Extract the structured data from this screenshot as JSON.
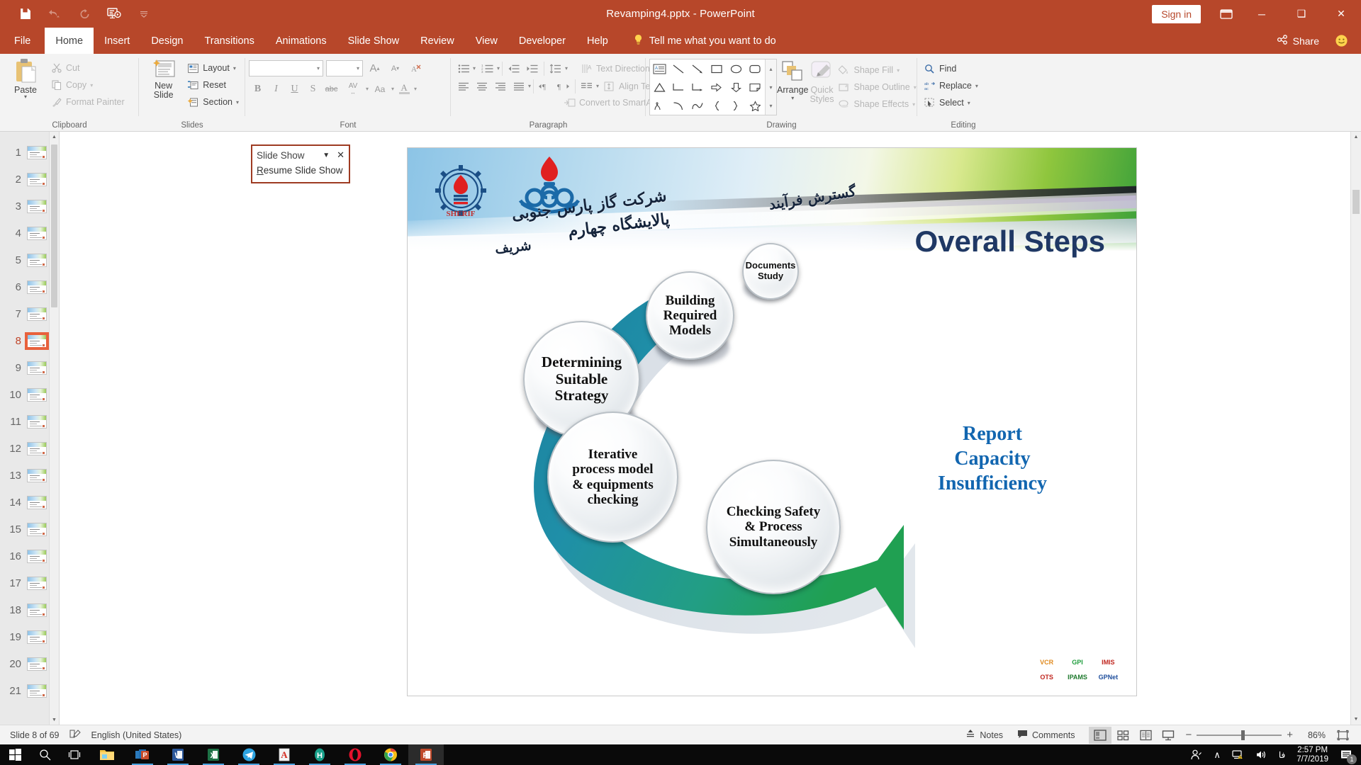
{
  "titlebar": {
    "document_title": "Revamping4.pptx  -  PowerPoint",
    "sign_in": "Sign in",
    "qat": [
      {
        "name": "save-icon",
        "glyph": "💾"
      },
      {
        "name": "undo-icon",
        "glyph": "↶"
      },
      {
        "name": "redo-icon",
        "glyph": "↻"
      },
      {
        "name": "start-slideshow-icon",
        "glyph": "⌨"
      },
      {
        "name": "customize-qat-icon",
        "glyph": "≡"
      }
    ],
    "window_buttons": {
      "minimize": "─",
      "restore": "❑",
      "close": "✕"
    },
    "ribbon_display_options": "❐"
  },
  "tabs": {
    "items": [
      "File",
      "Home",
      "Insert",
      "Design",
      "Transitions",
      "Animations",
      "Slide Show",
      "Review",
      "View",
      "Developer",
      "Help"
    ],
    "active": "Home",
    "tell_me": "Tell me what you want to do",
    "share": "Share"
  },
  "ribbon": {
    "clipboard": {
      "label": "Clipboard",
      "paste": "Paste",
      "cut": "Cut",
      "copy": "Copy",
      "format_painter": "Format Painter"
    },
    "slides": {
      "label": "Slides",
      "new_slide": "New\nSlide",
      "new_slide_line1": "New",
      "new_slide_line2": "Slide",
      "layout": "Layout",
      "reset": "Reset",
      "section": "Section"
    },
    "font": {
      "label": "Font",
      "font_name_value": "",
      "font_size_value": "",
      "grow": "A",
      "shrink": "A",
      "clear_formatting": "A",
      "bold": "B",
      "italic": "I",
      "underline": "U",
      "shadow": "S",
      "strikethrough": "abc",
      "character_spacing": "AV",
      "change_case": "Aa",
      "font_color": "A"
    },
    "paragraph": {
      "label": "Paragraph",
      "text_direction": "Text Direction",
      "align_text": "Align Text",
      "convert_smartart": "Convert to SmartArt"
    },
    "drawing": {
      "label": "Drawing",
      "arrange": "Arrange",
      "quick_styles_line1": "Quick",
      "quick_styles_line2": "Styles",
      "shape_fill": "Shape Fill",
      "shape_outline": "Shape Outline",
      "shape_effects": "Shape Effects"
    },
    "editing": {
      "label": "Editing",
      "find": "Find",
      "replace": "Replace",
      "select": "Select"
    }
  },
  "slideshow_popup": {
    "title": "Slide Show",
    "resume": "Resume Slide Show",
    "resume_accel": "R",
    "resume_rest": "esume Slide Show",
    "collapse_icon": "▼",
    "close_icon": "✕",
    "border_color": "#9e3b22"
  },
  "thumbnails": {
    "selected": 8,
    "items": [
      1,
      2,
      3,
      4,
      5,
      6,
      7,
      8,
      9,
      10,
      11,
      12,
      13,
      14,
      15,
      16,
      17,
      18,
      19,
      20,
      21
    ]
  },
  "slide": {
    "title": "Overall Steps",
    "title_color": "#1f3864",
    "farsi_header": "شرکت گاز پارس جنوبی\nپالایشگاه چهارم",
    "farsi_line1": "شرکت گاز پارس جنوبی",
    "farsi_line2": "پالایشگاه چهارم",
    "farsi_line3": "شریف",
    "farsi_right": "گسترش فرآیند",
    "logo_sherif_text": "SHERIF",
    "nodes": [
      {
        "id": "documents-study",
        "text": "Documents\nStudy",
        "line1": "Documents",
        "line2": "Study"
      },
      {
        "id": "building-required-models",
        "text": "Building Required Models",
        "line1": "Building",
        "line2": "Required",
        "line3": "Models"
      },
      {
        "id": "determining-suitable-strategy",
        "text": "Determining Suitable Strategy",
        "line1": "Determining",
        "line2": "Suitable",
        "line3": "Strategy"
      },
      {
        "id": "iterative-process-model",
        "text": "Iterative process model & equipments checking",
        "line1": "Iterative",
        "line2": "process model",
        "line3": "& equipments",
        "line4": "checking"
      },
      {
        "id": "checking-safety-process",
        "text": "Checking Safety & Process Simultaneously",
        "line1": "Checking Safety",
        "line2": "& Process",
        "line3": "Simultaneously"
      }
    ],
    "outcome": {
      "line1": "Report",
      "line2": "Capacity",
      "line3": "Insufficiency",
      "color": "#1266b0"
    },
    "arrow_color_start": "#1f8fa8",
    "arrow_color_end": "#1f9d55",
    "mini_logos": [
      "VCR",
      "GPI",
      "IMIS",
      "OTS",
      "IPAMS",
      "GPNet"
    ]
  },
  "status_bar": {
    "slide_indicator": "Slide 8 of 69",
    "language": "English (United States)",
    "notes": "Notes",
    "comments": "Comments",
    "zoom_percent": "86%",
    "zoom_value": 86,
    "views": [
      "normal-view",
      "slide-sorter-view",
      "reading-view",
      "slide-show-view"
    ],
    "active_view": "normal-view",
    "zoom_out": "−",
    "zoom_in": "+"
  },
  "taskbar": {
    "items": [
      {
        "name": "start-button",
        "glyph": "⊞"
      },
      {
        "name": "search-icon",
        "glyph": "🔍"
      },
      {
        "name": "task-view-icon",
        "glyph": "❑"
      },
      {
        "name": "file-explorer-icon",
        "glyph": "📁"
      },
      {
        "name": "office-apps-icon",
        "glyph": "P"
      },
      {
        "name": "word-icon",
        "glyph": "W"
      },
      {
        "name": "excel-icon",
        "glyph": "X"
      },
      {
        "name": "telegram-icon",
        "glyph": "✈"
      },
      {
        "name": "acrobat-reader-icon",
        "glyph": "A"
      },
      {
        "name": "hysys-icon",
        "glyph": "H"
      },
      {
        "name": "opera-icon",
        "glyph": "O"
      },
      {
        "name": "chrome-icon",
        "glyph": "●"
      },
      {
        "name": "powerpoint-icon",
        "glyph": "P"
      }
    ],
    "tray": {
      "people_icon": "⚹",
      "show_hidden_icon": "∧",
      "network_icon": "🖥",
      "volume_icon": "🔊",
      "language": "فا",
      "time": "2:57 PM",
      "date": "7/7/2019",
      "notification_count": "1"
    }
  }
}
